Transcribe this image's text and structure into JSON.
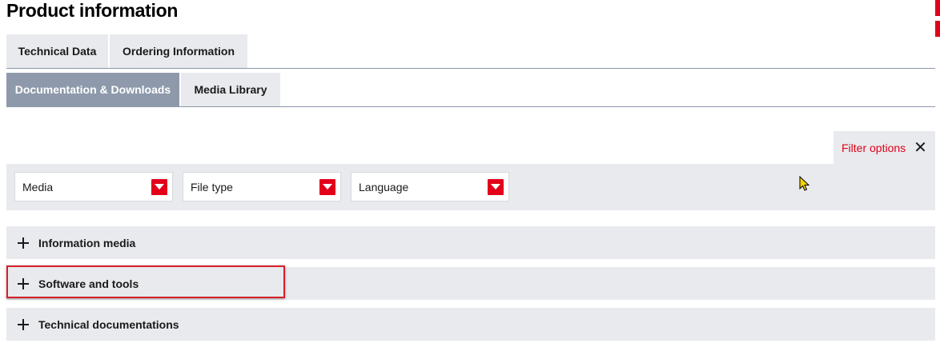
{
  "page": {
    "title": "Product information"
  },
  "tabs_row1": [
    {
      "label": "Technical Data"
    },
    {
      "label": "Ordering Information"
    }
  ],
  "tabs_row2": [
    {
      "label": "Documentation & Downloads",
      "active": true
    },
    {
      "label": "Media Library"
    }
  ],
  "filter": {
    "toggle_label": "Filter options",
    "close_icon": "close-icon",
    "selects": [
      {
        "value": "Media"
      },
      {
        "value": "File type"
      },
      {
        "value": "Language"
      }
    ]
  },
  "accordion": [
    {
      "label": "Information media"
    },
    {
      "label": "Software and tools",
      "highlighted": true
    },
    {
      "label": "Technical documentations"
    }
  ],
  "colors": {
    "accent": "#e2001a",
    "active_tab": "#8e9aab",
    "panel_bg": "#e8eaed"
  }
}
